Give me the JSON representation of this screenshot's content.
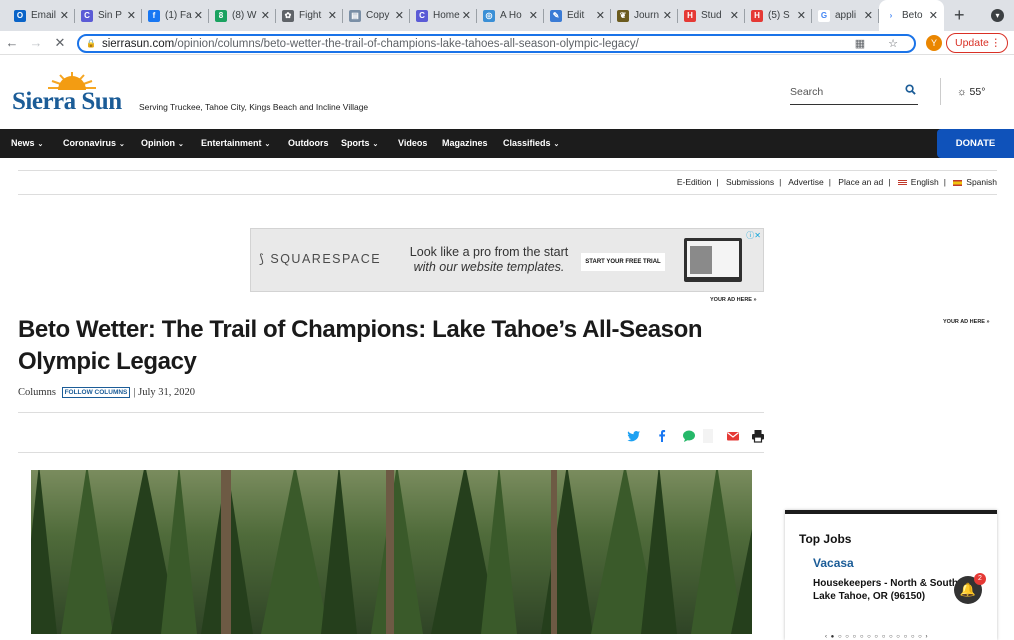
{
  "browser": {
    "tabs": [
      {
        "label": "Email",
        "color": "#0a64c8",
        "glyph": "O"
      },
      {
        "label": "Sin P",
        "color": "#5b5bd6",
        "glyph": "C"
      },
      {
        "label": "(1) Fa",
        "color": "#1877f2",
        "glyph": "f"
      },
      {
        "label": "(8) W",
        "color": "#1aa260",
        "glyph": "8"
      },
      {
        "label": "Fight",
        "color": "#5f6368",
        "glyph": "✿"
      },
      {
        "label": "Copy",
        "color": "#7a8fa6",
        "glyph": "▤"
      },
      {
        "label": "Home",
        "color": "#5b5bd6",
        "glyph": "C"
      },
      {
        "label": "A Ho",
        "color": "#3a8fd6",
        "glyph": "◎"
      },
      {
        "label": "Edit",
        "color": "#3a7bd5",
        "glyph": "✎"
      },
      {
        "label": "Journ",
        "color": "#6b5b1e",
        "glyph": "❦"
      },
      {
        "label": "Stud",
        "color": "#e53935",
        "glyph": "H"
      },
      {
        "label": "(5) S",
        "color": "#e53935",
        "glyph": "H"
      },
      {
        "label": "appli",
        "color": "#ffffff",
        "glyph": "G"
      },
      {
        "label": "Beto",
        "color": "#ffffff",
        "glyph": "›"
      }
    ],
    "close_glyph": "✕",
    "new_tab_glyph": "+",
    "tab_search_glyph": "▾",
    "back_glyph": "←",
    "forward_glyph": "→",
    "reload_glyph": "✕",
    "url_host": "sierrasun.com",
    "url_path": "/opinion/columns/beto-wetter-the-trail-of-champions-lake-tahoes-all-season-olympic-legacy/",
    "omnibox_icons": "▦ ☆",
    "profile_initial": "Y",
    "update_label": "Update",
    "update_menu": "⋮"
  },
  "site": {
    "logo": "Sierra Sun",
    "tagline": "Serving Truckee, Tahoe City, Kings Beach and Incline Village",
    "search_placeholder": "Search",
    "search_glyph": "🔍",
    "weather": "☼  55°",
    "nav": [
      {
        "label": "News",
        "caret": true
      },
      {
        "label": "Coronavirus",
        "caret": true
      },
      {
        "label": "Opinion",
        "caret": true
      },
      {
        "label": "Entertainment",
        "caret": true
      },
      {
        "label": "Outdoors",
        "caret": false
      },
      {
        "label": "Sports",
        "caret": true
      },
      {
        "label": "Videos",
        "caret": false
      },
      {
        "label": "Magazines",
        "caret": false
      },
      {
        "label": "Classifieds",
        "caret": true
      }
    ],
    "caret_glyph": "⌄",
    "donate": "DONATE",
    "utility": {
      "eedition": "E-Edition",
      "submissions": "Submissions",
      "advertise": "Advertise",
      "place_ad": "Place an ad",
      "english": "English",
      "spanish": "Spanish",
      "sep": "|"
    }
  },
  "ad": {
    "brand_mark": "⟆",
    "brand": "SQUARESPACE",
    "headline_1": "Look like a pro from the start",
    "headline_2": "with our website templates.",
    "cta": "START YOUR FREE TRIAL",
    "choices": "ⓘ✕",
    "your_ad_here": "YOUR AD HERE »"
  },
  "article": {
    "title": "Beto Wetter: The Trail of Champions: Lake Tahoe’s All-Season Olympic Legacy",
    "section": "Columns",
    "follow": "FOLLOW COLUMNS",
    "date": "| July 31, 2020"
  },
  "sidebar": {
    "your_ad_here": "YOUR AD HERE »",
    "jobs_title": "Top Jobs",
    "company": "Vacasa",
    "job_desc": "Housekeepers - North & South Lake Tahoe, OR (96150)",
    "pager": "‹ ● ○ ○ ○ ○ ○ ○ ○ ○ ○ ○ ○ ○ ›",
    "notification_count": "2",
    "bell_glyph": "🔔"
  },
  "colors": {
    "brand_blue": "#1b5c97",
    "nav_bg": "#1c1c1c",
    "donate_bg": "#0f52ba",
    "twitter": "#1da1f2",
    "facebook": "#1877f2",
    "sms": "#25b869",
    "email": "#e53935"
  }
}
